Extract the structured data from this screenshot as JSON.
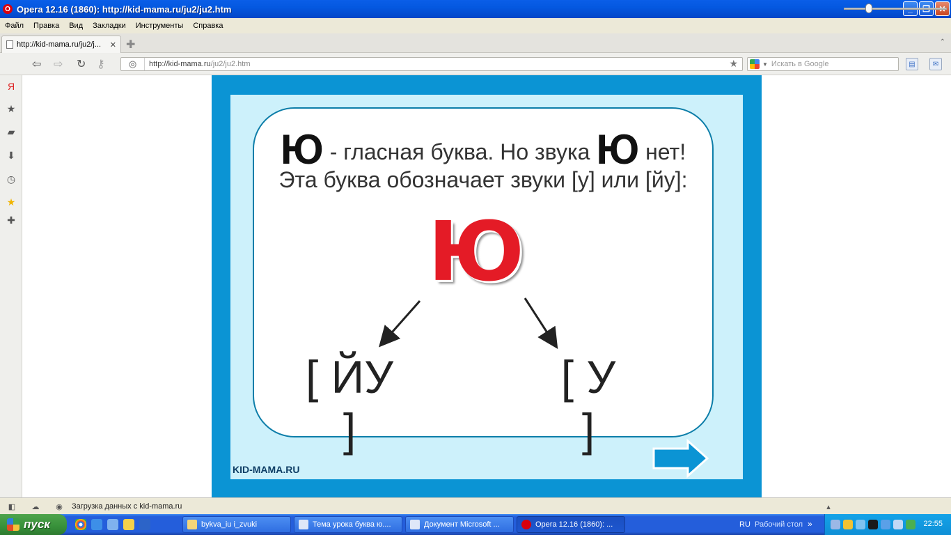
{
  "window": {
    "title": "Opera 12.16 (1860): http://kid-mama.ru/ju2/ju2.htm",
    "minimize": "_",
    "maximize": "❐",
    "close": "✕"
  },
  "menu": [
    "Файл",
    "Правка",
    "Вид",
    "Закладки",
    "Инструменты",
    "Справка"
  ],
  "tab": {
    "label": "http://kid-mama.ru/ju2/j...",
    "close": "✕"
  },
  "address": {
    "host": "http://kid-mama.ru",
    "path": "/ju2/ju2.htm"
  },
  "search": {
    "placeholder": "Искать в Google"
  },
  "slide": {
    "line1_letter_a": "Ю",
    "line1_text_a": " - гласная буква. Но звука ",
    "line1_letter_b": "Ю",
    "line1_text_b": " нет!",
    "line2": "Эта буква обозначает звуки [у] или [йу]:",
    "big_letter": "Ю",
    "sound_left": "[ ЙУ ]",
    "sound_right": "[ У ]",
    "brand": "KID-MAMA.RU"
  },
  "status": {
    "text": "Загрузка данных с kid-mama.ru"
  },
  "zoom": {
    "level_fraction": 0.24
  },
  "taskbar": {
    "start_label": "пуск",
    "tasks": [
      {
        "label": "bykva_iu i_zvuki",
        "active": false
      },
      {
        "label": "Тема урока буква ю....",
        "active": false
      },
      {
        "label": "Документ Microsoft ...",
        "active": false
      },
      {
        "label": "Opera 12.16 (1860): ...",
        "active": true
      }
    ],
    "lang": "RU",
    "desktop": "Рабочий стол",
    "clock": "22:55"
  },
  "colors": {
    "slide_border": "#0b94d4",
    "slide_background": "#cdf1fb",
    "letter_red": "#e41b26",
    "arrow_blue": "#0b94d4"
  }
}
